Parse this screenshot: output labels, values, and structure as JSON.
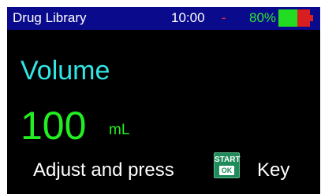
{
  "status_bar": {
    "title": "Drug Library",
    "time": "10:00",
    "alarm_indicator": "-",
    "battery_percent_text": "80%",
    "battery_level": 0.6,
    "battery_fill_color": "#22dd22",
    "battery_empty_color": "#d81e1e"
  },
  "parameter": {
    "label": "Volume",
    "value": "100",
    "unit": "mL"
  },
  "prompt": {
    "text_before": "Adjust and press",
    "key_line1": "START",
    "key_line2": "OK",
    "text_after": "Key"
  },
  "colors": {
    "status_bar_bg": "#0a0a8c",
    "label_color": "#33e6e6",
    "value_color": "#22ee22",
    "key_color": "#1f8a5a"
  },
  "icons": {
    "battery": "battery-icon",
    "start_ok": "start-ok-key-icon"
  }
}
